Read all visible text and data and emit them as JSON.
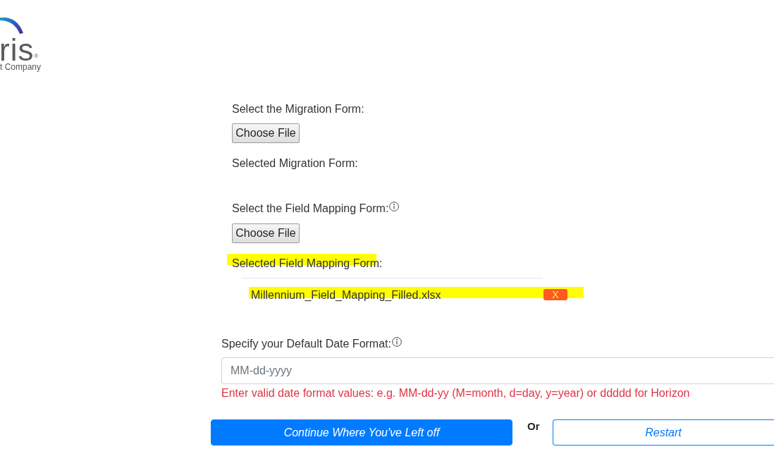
{
  "logo": {
    "wordmark": "ris",
    "registered": "®",
    "tagline": "t Company"
  },
  "upload_sections": [
    {
      "label": "Select the Migration Form:",
      "info": false,
      "button": "Choose File",
      "selected_label": "Selected Migration Form:",
      "label_highlighted": false
    },
    {
      "label": "Select the Field Mapping Form:",
      "info": true,
      "button": "Choose File",
      "selected_label": "Selected Field Mapping Form:",
      "label_highlighted": true,
      "files": [
        {
          "name": "Millennium_Field_Mapping_Filled.xlsx",
          "highlighted": true,
          "remove": "X"
        }
      ]
    }
  ],
  "date_format": {
    "label": "Specify your Default Date Format:",
    "info": true,
    "placeholder": "MM-dd-yyyy",
    "error": "Enter valid date format values: e.g. MM-dd-yy (M=month, d=day, y=year) or ddddd for Horizon"
  },
  "actions": {
    "continue": "Continue Where You've Left off",
    "separator": "Or",
    "restart": "Restart"
  }
}
